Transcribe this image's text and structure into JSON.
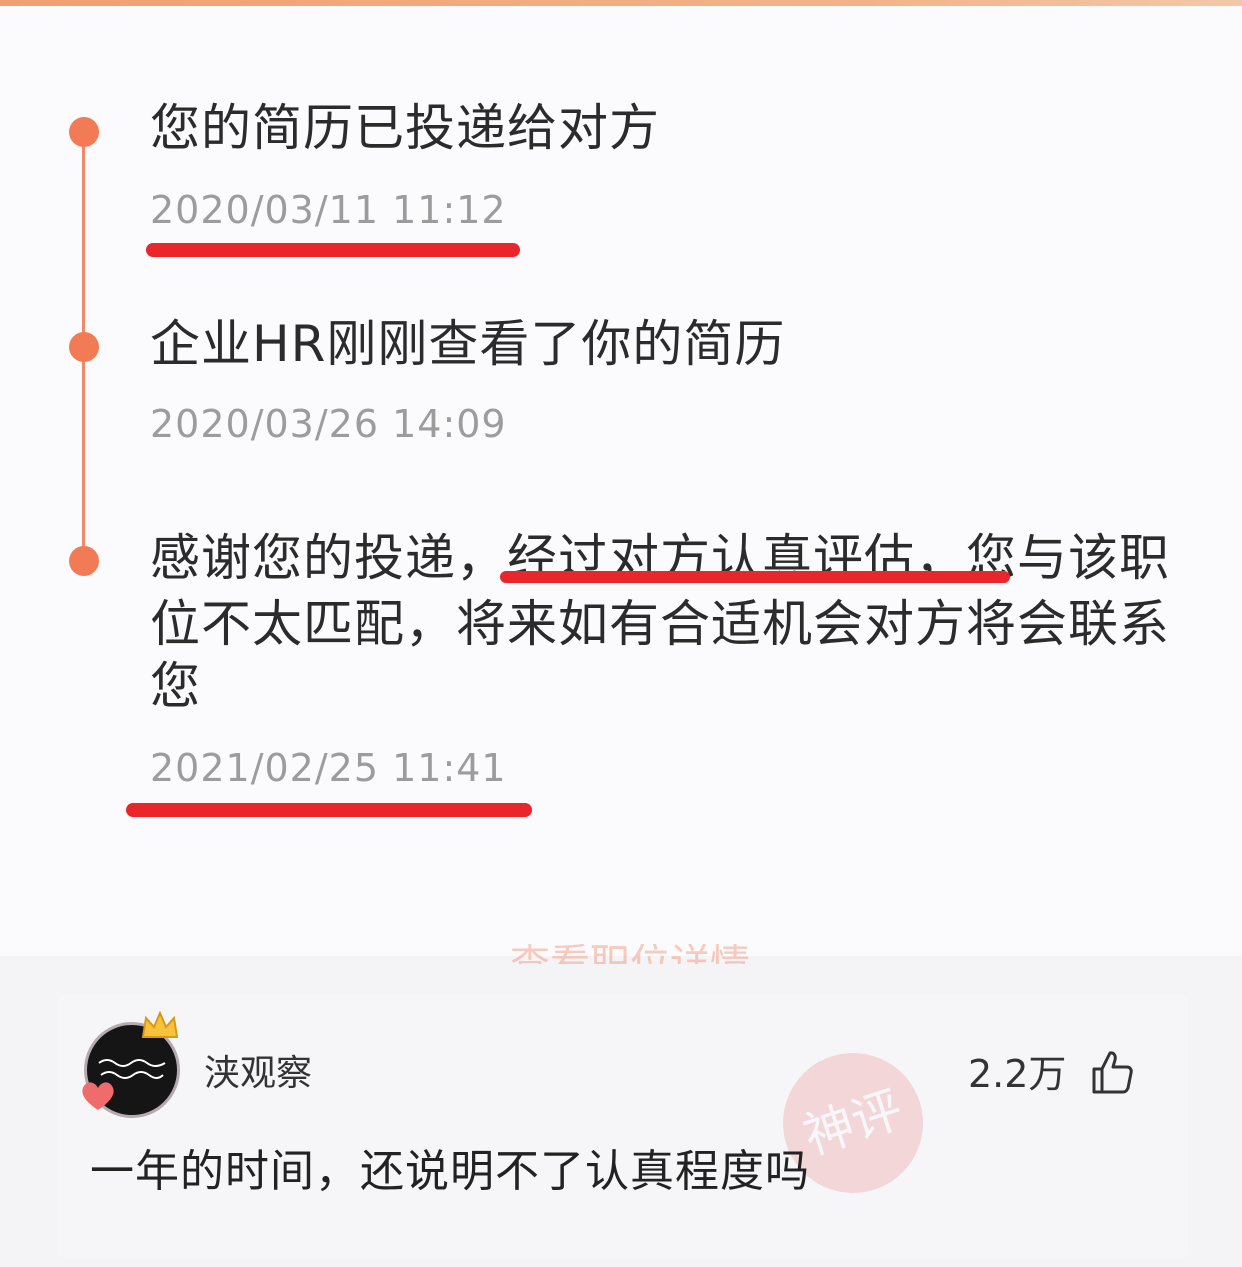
{
  "timeline": {
    "events": [
      {
        "title": "您的简历已投递给对方",
        "time": "2020/03/11 11:12"
      },
      {
        "title": "企业HR刚刚查看了你的简历",
        "time": "2020/03/26 14:09"
      },
      {
        "title_line1": "感谢您的投递，经过对方认真评估，您与该职",
        "title_line2": "位不太匹配，将来如有合适机会对方将会联系",
        "title_line3": "您",
        "time": "2021/02/25 11:41"
      }
    ],
    "partial_link": "查看职位详情"
  },
  "comment": {
    "username": "浃观察",
    "likes": "2.2万",
    "text": "一年的时间，还说明不了认真程度吗"
  },
  "colors": {
    "timeline_accent": "#f27a55",
    "highlight_red": "#e8262b"
  }
}
